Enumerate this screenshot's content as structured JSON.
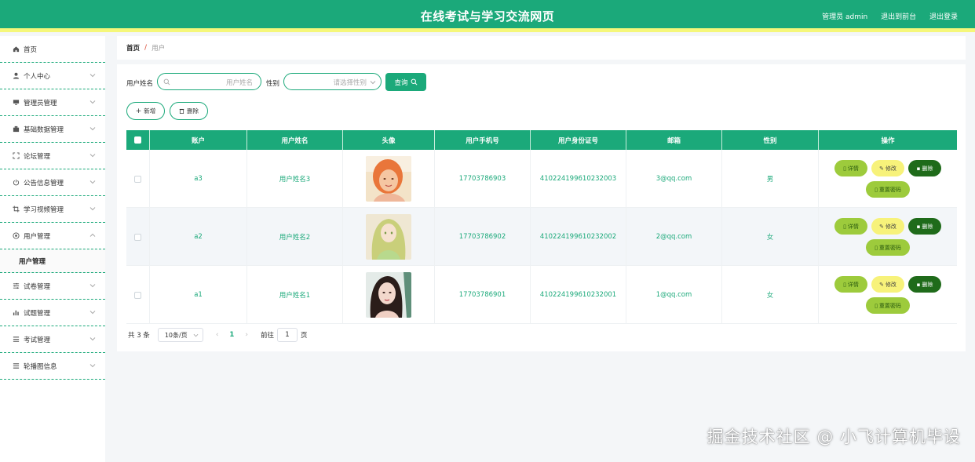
{
  "header": {
    "title": "在线考试与学习交流网页",
    "admin_label": "管理员 admin",
    "back_label": "退出到前台",
    "logout_label": "退出登录"
  },
  "sidebar": {
    "items": [
      {
        "label": "首页",
        "icon": "home-icon"
      },
      {
        "label": "个人中心",
        "icon": "user-icon"
      },
      {
        "label": "管理员管理",
        "icon": "monitor-icon"
      },
      {
        "label": "基础数据管理",
        "icon": "database-icon"
      },
      {
        "label": "论坛管理",
        "icon": "expand-icon"
      },
      {
        "label": "公告信息管理",
        "icon": "power-icon"
      },
      {
        "label": "学习视频管理",
        "icon": "crop-icon"
      },
      {
        "label": "用户管理",
        "icon": "help-icon"
      },
      {
        "label": "试卷管理",
        "icon": "sliders-icon"
      },
      {
        "label": "试题管理",
        "icon": "bar-chart-icon"
      },
      {
        "label": "考试管理",
        "icon": "list-icon"
      },
      {
        "label": "轮播图信息",
        "icon": "menu-icon"
      }
    ],
    "sub_item": "用户管理"
  },
  "breadcrumb": {
    "home": "首页",
    "sep": "/",
    "current": "用户"
  },
  "filters": {
    "name_label": "用户姓名",
    "name_placeholder": "用户姓名",
    "gender_label": "性别",
    "gender_placeholder": "请选择性别",
    "query_label": "查询"
  },
  "actions": {
    "add_label": "新增",
    "delete_label": "删除"
  },
  "table": {
    "headers": [
      "账户",
      "用户姓名",
      "头像",
      "用户手机号",
      "用户身份证号",
      "邮箱",
      "性别",
      "操作"
    ],
    "rows": [
      {
        "account": "a3",
        "name": "用户姓名3",
        "phone": "17703786903",
        "idcard": "410224199610232003",
        "email": "3@qq.com",
        "gender": "男"
      },
      {
        "account": "a2",
        "name": "用户姓名2",
        "phone": "17703786902",
        "idcard": "410224199610232002",
        "email": "2@qq.com",
        "gender": "女"
      },
      {
        "account": "a1",
        "name": "用户姓名1",
        "phone": "17703786901",
        "idcard": "410224199610232001",
        "email": "1@qq.com",
        "gender": "女"
      }
    ],
    "ops": {
      "detail": "详情",
      "edit": "修改",
      "delete": "删除",
      "reset": "重置密码"
    }
  },
  "pager": {
    "total": "共 3 条",
    "page_size": "10条/页",
    "prev": "‹",
    "page": "1",
    "next": "›",
    "goto": "前往",
    "goto_value": "1",
    "page_unit": "页"
  },
  "watermark": "掘金技术社区 @ 小飞计算机毕设",
  "colors": {
    "primary": "#1ba97a",
    "accent": "#f5f77a",
    "detail": "#9dcb3c",
    "edit": "#f7f27a",
    "delete": "#1f6b1a"
  }
}
